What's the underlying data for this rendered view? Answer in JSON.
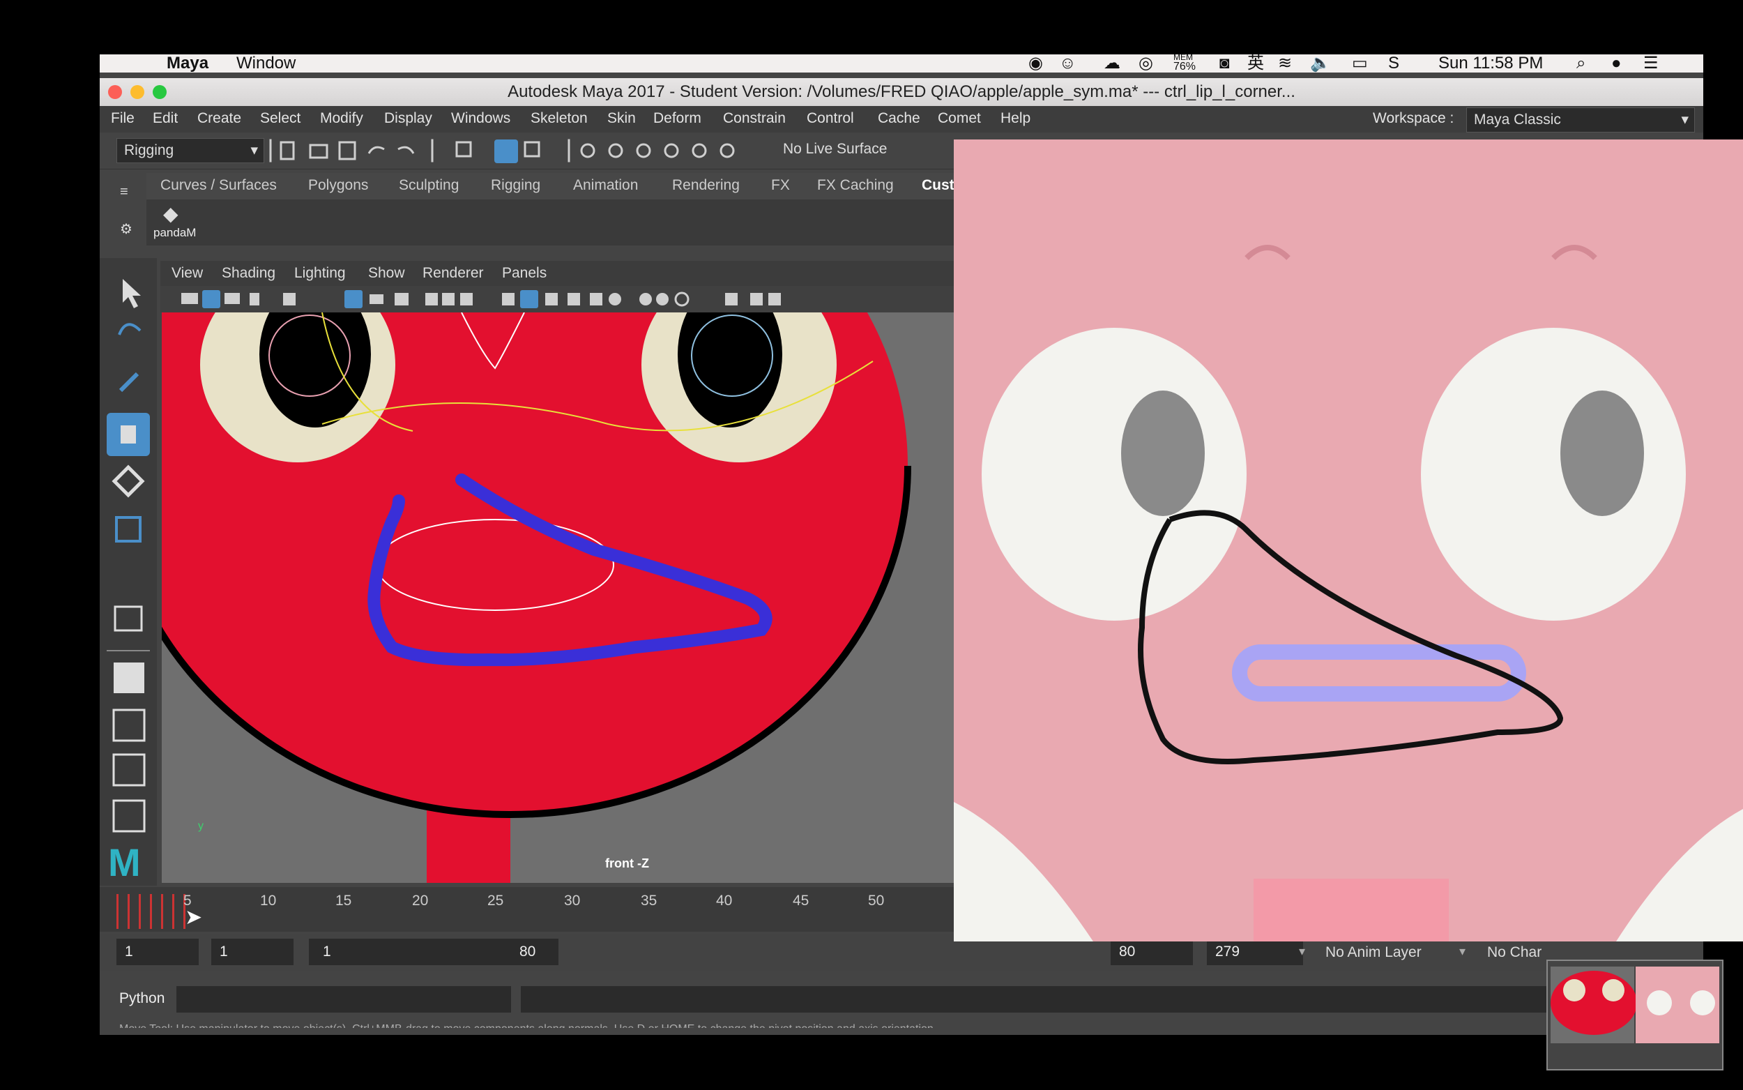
{
  "mac_menubar": {
    "app_name": "Maya",
    "menu_window": "Window",
    "mem_label": "MEM",
    "mem_value": "76%",
    "ime": "英",
    "clock": "Sun 11:58 PM"
  },
  "window": {
    "title": "Autodesk Maya 2017 - Student Version: /Volumes/FRED QIAO/apple/apple_sym.ma*   ---   ctrl_lip_l_corner..."
  },
  "menubar": {
    "items": [
      "File",
      "Edit",
      "Create",
      "Select",
      "Modify",
      "Display",
      "Windows",
      "Skeleton",
      "Skin",
      "Deform",
      "Constrain",
      "Control",
      "Cache",
      "Comet",
      "Help"
    ],
    "workspace_label": "Workspace :",
    "workspace_value": "Maya Classic"
  },
  "toolbar": {
    "menuset": "Rigging",
    "live_surface": "No Live Surface"
  },
  "shelf": {
    "tabs": [
      "Curves / Surfaces",
      "Polygons",
      "Sculpting",
      "Rigging",
      "Animation",
      "Rendering",
      "FX",
      "FX Caching",
      "Cust"
    ],
    "item_label": "pandaM"
  },
  "viewport": {
    "menus": [
      "View",
      "Shading",
      "Lighting",
      "Show",
      "Renderer",
      "Panels"
    ],
    "camera_label": "front -Z",
    "axis_y": "y"
  },
  "timeline": {
    "ticks": [
      "5",
      "10",
      "15",
      "20",
      "25",
      "30",
      "35",
      "40",
      "45",
      "50"
    ]
  },
  "range": {
    "start_time": "1",
    "playback_start": "1",
    "range_start": "1",
    "range_end": "80",
    "playback_end": "80",
    "end_time": "279",
    "anim_layer": "No Anim Layer",
    "character": "No Char"
  },
  "cmdline": {
    "language": "Python",
    "help_text": "Move Tool: Use manipulator to move object(s). Ctrl+MMB-drag to move components along normals. Use D or HOME to change the pivot position and axis orientation."
  },
  "colors": {
    "face_red": "#e3102f",
    "curve_blue": "#3a2fd8",
    "overlay_pink": "#e9a9b1",
    "maya_active_blue": "#4a8fc9"
  }
}
